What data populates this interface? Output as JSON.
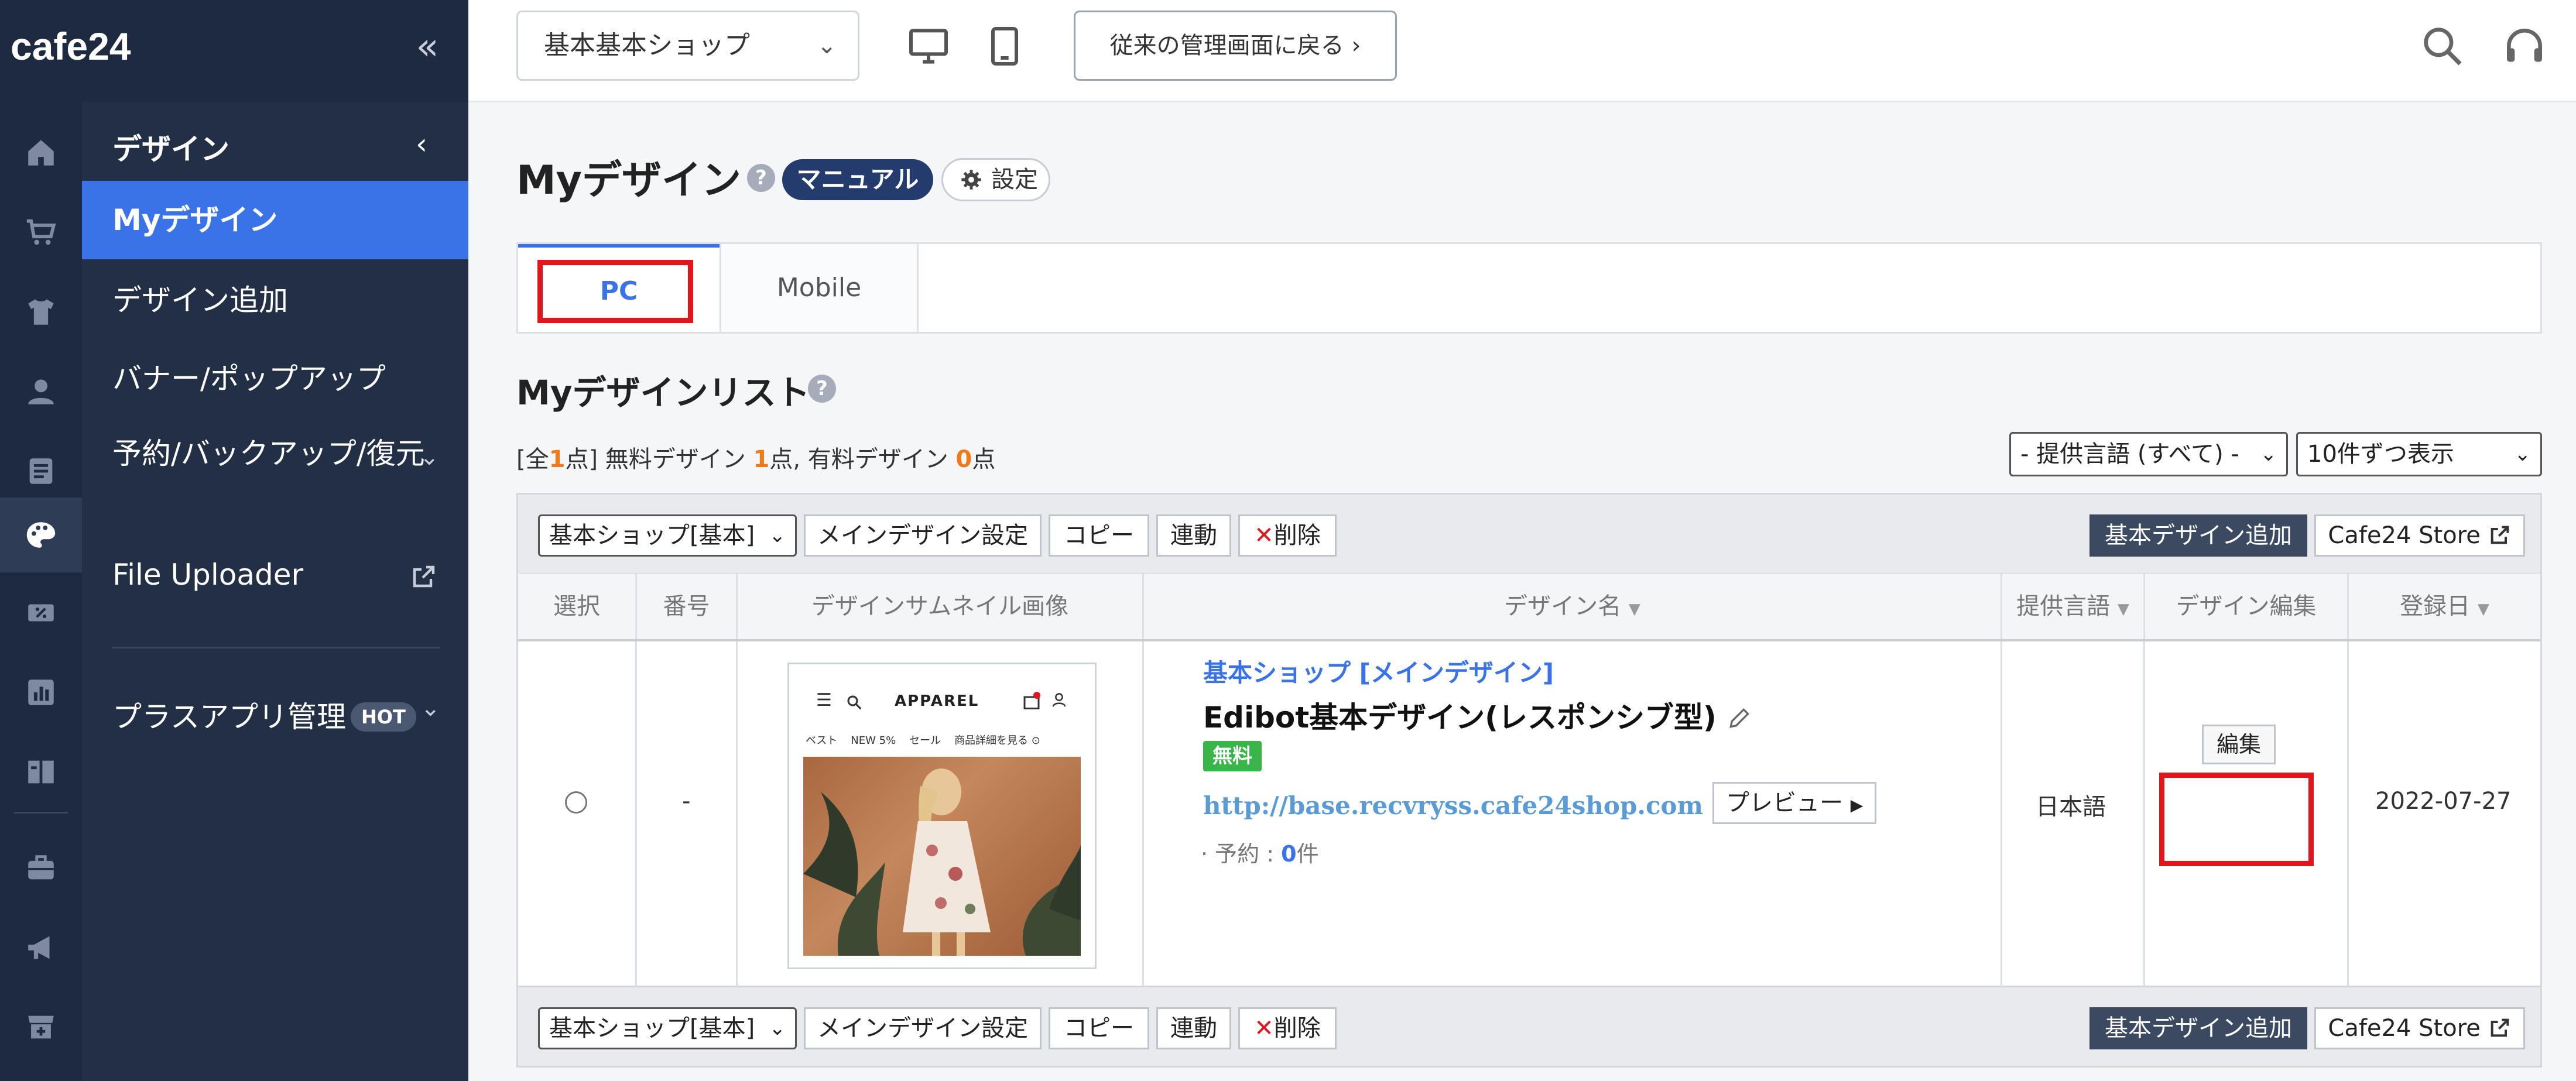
{
  "brand": {
    "logo_text": "cafe24"
  },
  "topbar": {
    "shop_select": "基本基本ショップ",
    "legacy_button": "従来の管理画面に戻る"
  },
  "subnav": {
    "header": "デザイン",
    "items": [
      {
        "label": "Myデザイン"
      },
      {
        "label": "デザイン追加"
      },
      {
        "label": "バナー/ポップアップ"
      },
      {
        "label": "予約/バックアップ/復元"
      },
      {
        "label": "File Uploader"
      },
      {
        "label": "プラスアプリ管理"
      }
    ],
    "hot_badge": "HOT"
  },
  "page": {
    "title": "Myデザイン",
    "manual_label": "マニュアル",
    "setting_label": "設定",
    "help_mark": "?"
  },
  "tabs": [
    {
      "label": "PC"
    },
    {
      "label": "Mobile"
    }
  ],
  "list": {
    "title": "Myデザインリスト",
    "summary": {
      "open": "[全",
      "total": "1",
      "close": "点] 無料デザイン ",
      "free": "1",
      "mid": "点, 有料デザイン ",
      "paid": "0",
      "end": "点"
    },
    "lang_filter": "- 提供言語 (すべて) -",
    "per_page": "10件ずつ表示"
  },
  "toolbar": {
    "shop_filter": "基本ショップ[基本]",
    "main_design_btn": "メインデザイン設定",
    "copy_btn": "コピー",
    "link_btn": "連動",
    "delete_x": "✕",
    "delete_btn": "削除",
    "add_basic_btn": "基本デザイン追加",
    "store_btn": "Cafe24 Store"
  },
  "table": {
    "columns": [
      "選択",
      "番号",
      "デザインサムネイル画像",
      "デザイン名",
      "提供言語",
      "デザイン編集",
      "登録日"
    ],
    "row": {
      "number": "-",
      "shop_label": "基本ショップ [メインデザイン]",
      "design_name": "Edibot基本デザイン(レスポンシブ型)",
      "free_badge": "無料",
      "url": "http://base.recvryss.cafe24shop.com",
      "preview_btn": "プレビュー",
      "reserve_label": "予約 : ",
      "reserve_count": "0",
      "reserve_unit": "件",
      "language": "日本語",
      "edit_btn": "編集",
      "date": "2022-07-27"
    },
    "thumbnail": {
      "brand": "APPAREL",
      "nav": [
        "ベスト",
        "NEW 5%",
        "セール",
        "商品詳細を見る"
      ]
    }
  },
  "colors": {
    "sidebar_dark": "#1e2a3f",
    "sidebar_sub": "#222f45",
    "accent_blue": "#3a73e8",
    "highlight_red": "#e0161c",
    "free_green": "#39b54a",
    "count_orange": "#f07a1a"
  }
}
